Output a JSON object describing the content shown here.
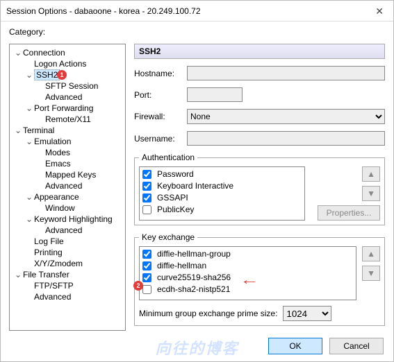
{
  "title": "Session Options - dabaoone - korea - 20.249.100.72",
  "category_label": "Category:",
  "tree": {
    "connection": "Connection",
    "logon_actions": "Logon Actions",
    "ssh2": "SSH2",
    "sftp_session": "SFTP Session",
    "ssh2_advanced": "Advanced",
    "port_forwarding": "Port Forwarding",
    "remote_x11": "Remote/X11",
    "terminal": "Terminal",
    "emulation": "Emulation",
    "modes": "Modes",
    "emacs": "Emacs",
    "mapped_keys": "Mapped Keys",
    "em_advanced": "Advanced",
    "appearance": "Appearance",
    "window": "Window",
    "keyword_highlighting": "Keyword Highlighting",
    "kh_advanced": "Advanced",
    "log_file": "Log File",
    "printing": "Printing",
    "xy_zmodem": "X/Y/Zmodem",
    "file_transfer": "File Transfer",
    "ftp_sftp": "FTP/SFTP",
    "ft_advanced": "Advanced"
  },
  "panel_title": "SSH2",
  "labels": {
    "hostname": "Hostname:",
    "port": "Port:",
    "firewall": "Firewall:",
    "username": "Username:",
    "authentication": "Authentication",
    "key_exchange": "Key exchange",
    "min_prime": "Minimum group exchange prime size:",
    "properties": "Properties..."
  },
  "fields": {
    "hostname": "",
    "port": "",
    "firewall": "None",
    "username": ""
  },
  "auth_methods": [
    {
      "label": "Password",
      "checked": true
    },
    {
      "label": "Keyboard Interactive",
      "checked": true
    },
    {
      "label": "GSSAPI",
      "checked": true
    },
    {
      "label": "PublicKey",
      "checked": false
    }
  ],
  "kex_methods": [
    {
      "label": "diffie-hellman-group",
      "checked": true
    },
    {
      "label": "diffie-hellman",
      "checked": true
    },
    {
      "label": "curve25519-sha256",
      "checked": true
    },
    {
      "label": "ecdh-sha2-nistp521",
      "checked": false
    }
  ],
  "prime_size": "1024",
  "buttons": {
    "ok": "OK",
    "cancel": "Cancel",
    "up": "▲",
    "down": "▼"
  },
  "annotations": {
    "badge1": "1",
    "badge2": "2"
  },
  "watermark": "向往的博客"
}
